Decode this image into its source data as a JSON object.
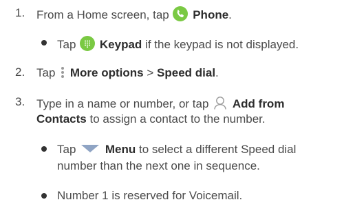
{
  "steps": {
    "s1": {
      "num": "1.",
      "pre": "From a Home screen, tap",
      "bold": "Phone",
      "post": "."
    },
    "s1_sub": {
      "pre": "Tap",
      "bold": "Keypad",
      "post": "if the keypad is not displayed."
    },
    "s2": {
      "num": "2.",
      "pre": "Tap",
      "bold1": "More options",
      "sep": ">",
      "bold2": "Speed dial",
      "post": "."
    },
    "s3": {
      "num": "3.",
      "pre": "Type in a name or number, or tap",
      "bold1": "Add from",
      "bold2": "Contacts",
      "post": "to assign a contact to the number."
    },
    "s3_sub1": {
      "pre": "Tap",
      "bold": "Menu",
      "post1": "to select a different Speed dial",
      "post2": "number than the next one in sequence."
    },
    "s3_sub2": {
      "text": "Number 1 is reserved for Voicemail."
    }
  },
  "icons": {
    "phone": "phone-icon",
    "keypad": "keypad-icon",
    "more_options": "more-options-icon",
    "contacts": "contact-icon",
    "menu": "menu-triangle-icon"
  },
  "colors": {
    "icon_green": "#7ac943",
    "icon_gray": "#9a9a9a",
    "menu_blue": "#8fa4c4",
    "text": "#4a4a4a"
  }
}
